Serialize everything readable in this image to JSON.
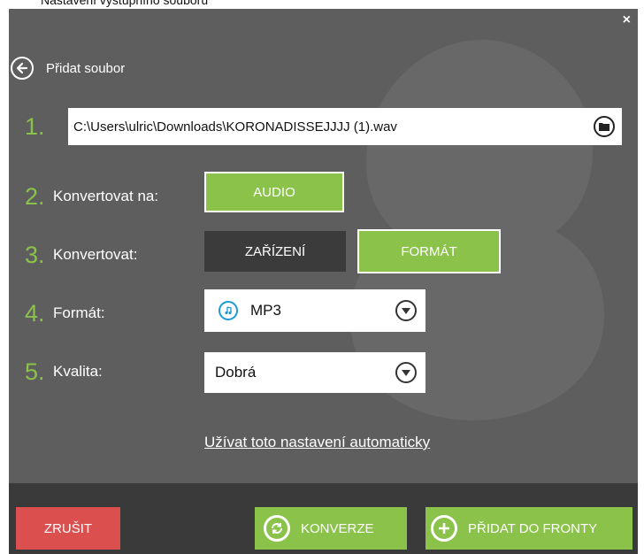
{
  "window": {
    "partial_title": "Nastavení výstupního souboru",
    "close_label": "×"
  },
  "back": {
    "label": "Přidat soubor"
  },
  "steps": [
    {
      "num": "1.",
      "label": ""
    },
    {
      "num": "2.",
      "label": "Konvertovat na:"
    },
    {
      "num": "3.",
      "label": "Konvertovat:"
    },
    {
      "num": "4.",
      "label": "Formát:"
    },
    {
      "num": "5.",
      "label": "Kvalita:"
    }
  ],
  "file": {
    "path": "C:\\Users\\ulric\\Downloads\\KORONADISSEJJJJ (1).wav",
    "icon": "folder-icon"
  },
  "convert_to": {
    "audio_label": "AUDIO"
  },
  "convert": {
    "device_label": "ZAŘÍZENÍ",
    "format_label": "FORMÁT"
  },
  "format": {
    "value": "MP3",
    "icon": "music-note-icon"
  },
  "quality": {
    "value": "Dobrá"
  },
  "auto_link": "Užívat toto nastavení automaticky",
  "footer": {
    "cancel_label": "ZRUŠIT",
    "convert_label": "KONVERZE",
    "queue_label": "PŘIDAT DO FRONTY"
  },
  "colors": {
    "accent": "#8bc34a",
    "cancel": "#dc4f4f",
    "panel": "#5e5e5e",
    "footer": "#3a3a3a",
    "device_btn": "#3b3b3b"
  }
}
